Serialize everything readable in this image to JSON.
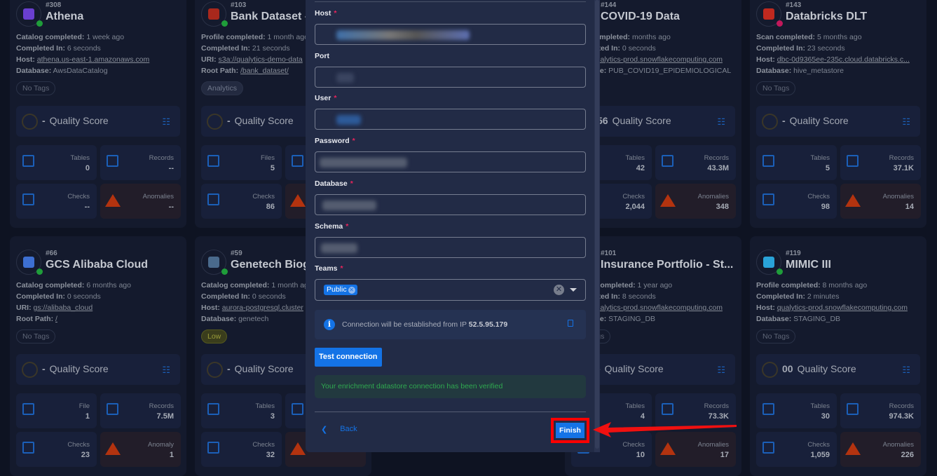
{
  "cards": [
    {
      "col": 0,
      "row": 0,
      "id": "#308",
      "title": "Athena",
      "logo": "#6a3fd0",
      "status": "#1f9d3a",
      "lines": [
        [
          "Catalog completed:",
          "1 week ago",
          false
        ],
        [
          "Completed In:",
          "6 seconds",
          false
        ],
        [
          "Host:",
          "athena.us-east-1.amazonaws.com",
          true
        ],
        [
          "Database:",
          "AwsDataCatalog",
          false
        ]
      ],
      "tag": "No Tags",
      "tag_style": "",
      "score": "-",
      "stats": [
        [
          "table",
          "Tables",
          "0"
        ],
        [
          "records",
          "Records",
          "--"
        ],
        [
          "check",
          "Checks",
          "--"
        ],
        [
          "anomaly",
          "Anomalies",
          "--"
        ]
      ]
    },
    {
      "col": 1,
      "row": 0,
      "id": "#103",
      "title": "Bank Dataset - ...",
      "logo": "#a9281c",
      "status": "#1f9d3a",
      "lines": [
        [
          "Profile completed:",
          "1 month ago",
          false
        ],
        [
          "Completed In:",
          "21 seconds",
          false
        ],
        [
          "URI:",
          "s3a://qualytics-demo-data",
          true
        ],
        [
          "Root Path:",
          "/bank_dataset/",
          true
        ]
      ],
      "tag": "Analytics",
      "tag_style": "analytics",
      "score": "-",
      "stats": [
        [
          "file",
          "Files",
          "5"
        ],
        [
          "records",
          "Records",
          ""
        ],
        [
          "check",
          "Checks",
          "86"
        ],
        [
          "anomaly",
          "Anomalies",
          ""
        ]
      ]
    },
    {
      "col": 3,
      "row": 0,
      "id": "#144",
      "title": "COVID-19 Data",
      "logo": "#2a8fc4",
      "status": "#1f9d3a",
      "lines": [
        [
          "Scan completed:",
          "months ago",
          false
        ],
        [
          "Completed In:",
          "0 seconds",
          false
        ],
        [
          "Host:",
          "qualytics-prod.snowflakecomputing.com",
          true
        ],
        [
          "Database:",
          "PUB_COVID19_EPIDEMIOLOGICAL",
          false
        ]
      ],
      "tag": "",
      "tag_style": "",
      "score": "56",
      "stats": [
        [
          "table",
          "Tables",
          "42"
        ],
        [
          "records",
          "Records",
          "43.3M"
        ],
        [
          "check",
          "Checks",
          "2,044"
        ],
        [
          "anomaly",
          "Anomalies",
          "348"
        ]
      ]
    },
    {
      "col": 4,
      "row": 0,
      "id": "#143",
      "title": "Databricks DLT",
      "logo": "#c0291f",
      "status": "#c2185b",
      "lines": [
        [
          "Scan completed:",
          "5 months ago",
          false
        ],
        [
          "Completed In:",
          "23 seconds",
          false
        ],
        [
          "Host:",
          "dbc-0d9365ee-235c.cloud.databricks.c...",
          true
        ],
        [
          "Database:",
          "hive_metastore",
          false
        ]
      ],
      "tag": "No Tags",
      "tag_style": "",
      "score": "-",
      "stats": [
        [
          "table",
          "Tables",
          "5"
        ],
        [
          "records",
          "Records",
          "37.1K"
        ],
        [
          "check",
          "Checks",
          "98"
        ],
        [
          "anomaly",
          "Anomalies",
          "14"
        ]
      ]
    },
    {
      "col": 0,
      "row": 1,
      "id": "#66",
      "title": "GCS Alibaba Cloud",
      "logo": "#3d6fd1",
      "status": "#1f9d3a",
      "lines": [
        [
          "Catalog completed:",
          "6 months ago",
          false
        ],
        [
          "Completed In:",
          "0 seconds",
          false
        ],
        [
          "URI:",
          "gs://alibaba_cloud",
          true
        ],
        [
          "Root Path:",
          "/",
          true
        ]
      ],
      "tag": "No Tags",
      "tag_style": "",
      "score": "-",
      "stats": [
        [
          "file",
          "File",
          "1"
        ],
        [
          "records",
          "Records",
          "7.5M"
        ],
        [
          "check",
          "Checks",
          "23"
        ],
        [
          "anomaly",
          "Anomaly",
          "1"
        ]
      ]
    },
    {
      "col": 1,
      "row": 1,
      "id": "#59",
      "title": "Genetech Biog...",
      "logo": "#4a6a8c",
      "status": "#1f9d3a",
      "lines": [
        [
          "Catalog completed:",
          "1 month ago",
          false
        ],
        [
          "Completed In:",
          "0 seconds",
          false
        ],
        [
          "Host:",
          "aurora-postgresql.cluster",
          true
        ],
        [
          "Database:",
          "genetech",
          false
        ]
      ],
      "tag": "Low",
      "tag_style": "low",
      "score": "-",
      "stats": [
        [
          "table",
          "Tables",
          "3"
        ],
        [
          "records",
          "Records",
          ""
        ],
        [
          "check",
          "Checks",
          "32"
        ],
        [
          "anomaly",
          "Anomalies",
          ""
        ]
      ]
    },
    {
      "col": 3,
      "row": 1,
      "id": "#101",
      "title": "Insurance Portfolio - St...",
      "logo": "#2a8fc4",
      "status": "#1f9d3a",
      "lines": [
        [
          "Profile completed:",
          "1 year ago",
          false
        ],
        [
          "Completed In:",
          "8 seconds",
          false
        ],
        [
          "Host:",
          "qualytics-prod.snowflakecomputing.com",
          true
        ],
        [
          "Database:",
          "STAGING_DB",
          false
        ]
      ],
      "tag": "No Tags",
      "tag_style": "",
      "score": "-",
      "stats": [
        [
          "table",
          "Tables",
          "4"
        ],
        [
          "records",
          "Records",
          "73.3K"
        ],
        [
          "check",
          "Checks",
          "10"
        ],
        [
          "anomaly",
          "Anomalies",
          "17"
        ]
      ]
    },
    {
      "col": 4,
      "row": 1,
      "id": "#119",
      "title": "MIMIC III",
      "logo": "#29a3d8",
      "status": "#1f9d3a",
      "lines": [
        [
          "Profile completed:",
          "8 months ago",
          false
        ],
        [
          "Completed In:",
          "2 minutes",
          false
        ],
        [
          "Host:",
          "qualytics-prod.snowflakecomputing.com",
          true
        ],
        [
          "Database:",
          "STAGING_DB",
          false
        ]
      ],
      "tag": "No Tags",
      "tag_style": "",
      "score": "00",
      "stats": [
        [
          "table",
          "Tables",
          "30"
        ],
        [
          "records",
          "Records",
          "974.3K"
        ],
        [
          "check",
          "Checks",
          "1,059"
        ],
        [
          "anomaly",
          "Anomalies",
          "226"
        ]
      ]
    }
  ],
  "quality_label": "Quality Score",
  "form": {
    "fields": [
      {
        "label": "Host",
        "required": true
      },
      {
        "label": "Port",
        "required": false
      },
      {
        "label": "User",
        "required": true
      },
      {
        "label": "Password",
        "required": true
      },
      {
        "label": "Database",
        "required": true
      },
      {
        "label": "Schema",
        "required": true
      }
    ],
    "teams_label": "Teams",
    "teams_value": "Public",
    "info_text": "Connection will be established from IP",
    "ip": "52.5.95.179",
    "test_button": "Test connection",
    "success_message": "Your enrichment datastore connection has been verified",
    "back_label": "Back",
    "finish_label": "Finish"
  },
  "colors": {
    "accent": "#1473e6",
    "required": "#e8245c",
    "success": "#2fa84f",
    "highlight": "#ff0000"
  }
}
